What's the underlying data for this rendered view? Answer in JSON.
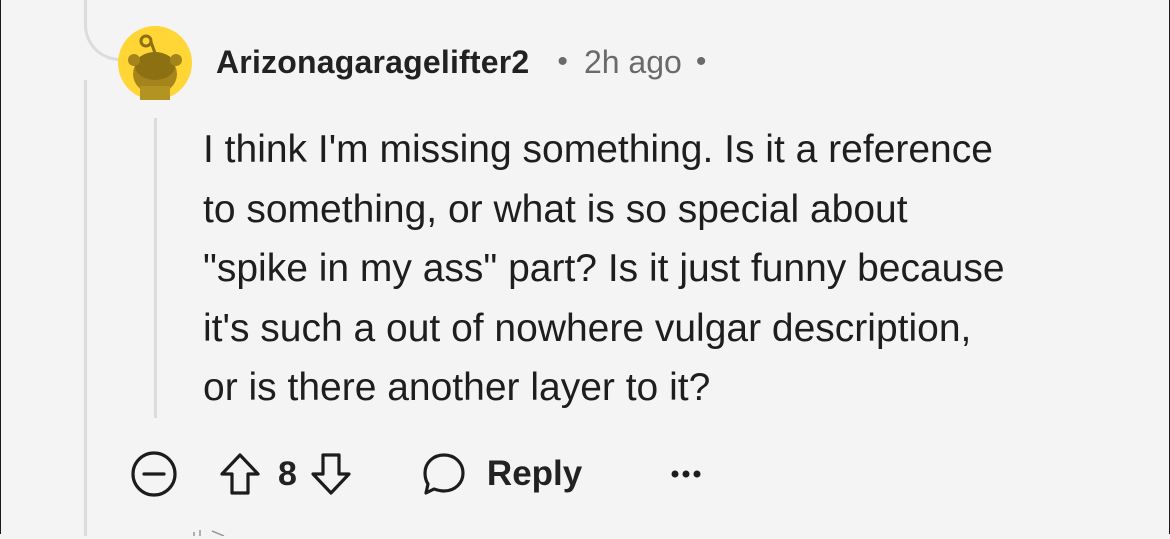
{
  "comment": {
    "username": "Arizonagaragelifter2",
    "separator": "•",
    "time": "2h ago",
    "body": "I think I'm missing something. Is it a reference\nto something, or what is so special about\n\"spike in my ass\" part? Is it just funny because\nit's such a out of nowhere vulgar description,\nor is there another layer to it?",
    "score": "8",
    "reply_label": "Reply"
  },
  "icons": {
    "avatar": "reddit-snoo-avatar",
    "collapse": "minus-circle-icon",
    "upvote": "arrow-up-icon",
    "downvote": "arrow-down-icon",
    "reply": "speech-bubble-icon",
    "more": "ellipsis-icon"
  },
  "colors": {
    "background": "#f4f4f4",
    "avatar_bg": "#ffd635",
    "thread_line": "#dcdcdc",
    "meta_text": "#6a6a6a"
  }
}
